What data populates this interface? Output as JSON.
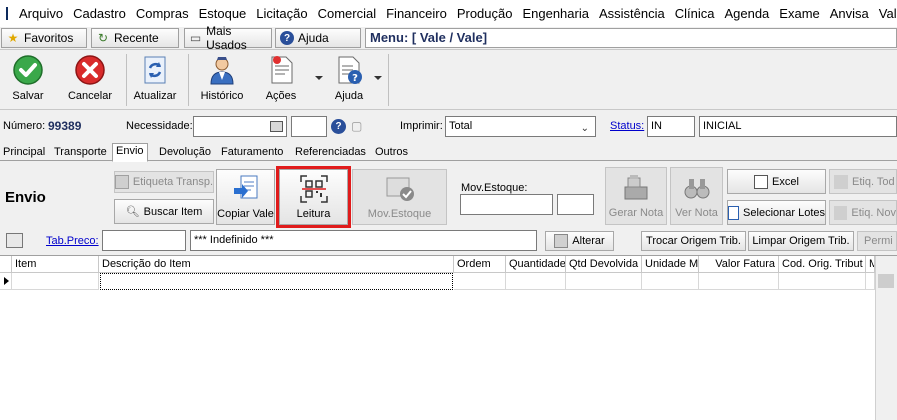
{
  "menubar": {
    "items": [
      "Arquivo",
      "Cadastro",
      "Compras",
      "Estoque",
      "Licitação",
      "Comercial",
      "Financeiro",
      "Produção",
      "Engenharia",
      "Assistência",
      "Clínica",
      "Agenda",
      "Exame",
      "Anvisa",
      "Vale"
    ]
  },
  "favbar": {
    "favoritos": "Favoritos",
    "recente": "Recente",
    "mais_usados": "Mais Usados",
    "ajuda": "Ajuda",
    "menu_path": "Menu: [ Vale / Vale]"
  },
  "toolbar": {
    "salvar": "Salvar",
    "cancelar": "Cancelar",
    "atualizar": "Atualizar",
    "historico": "Histórico",
    "acoes": "Ações",
    "ajuda": "Ajuda"
  },
  "form": {
    "numero_label": "Número:",
    "numero_value": "99389",
    "necessidade_label": "Necessidade:",
    "necessidade_value": "",
    "imprimir_label": "Imprimir:",
    "imprimir_value": "Total",
    "status_label": "Status:",
    "status_code": "IN",
    "status_desc": "INICIAL"
  },
  "tabs": [
    "Principal",
    "Transporte",
    "Envio",
    "Devolução",
    "Faturamento",
    "Referenciadas",
    "Outros"
  ],
  "active_tab": "Envio",
  "envio": {
    "title": "Envio",
    "etiqueta_transp": "Etiqueta Transp.",
    "buscar_item": "Buscar Item",
    "copiar_vale": "Copiar Vale",
    "leitura": "Leitura",
    "mov_estoque_btn": "Mov.Estoque",
    "mov_estoque_label": "Mov.Estoque:",
    "gerar_nota": "Gerar Nota",
    "ver_nota": "Ver Nota",
    "excel": "Excel",
    "selecionar_lotes": "Selecionar Lotes",
    "etiq_todos": "Etiq. Tod",
    "etiq_novos": "Etiq. Nov"
  },
  "pricebar": {
    "tab_preco_label": "Tab.Preco:",
    "tab_preco_value": "",
    "indefinido": "*** Indefinido ***",
    "alterar": "Alterar",
    "trocar_origem": "Trocar Origem Trib.",
    "limpar_origem": "Limpar Origem Trib.",
    "permitir": "Permi"
  },
  "grid": {
    "columns": [
      "Item",
      "Descrição do Item",
      "Ordem",
      "Quantidade",
      "Qtd Devolvida",
      "Unidade Me",
      "Valor Fatura",
      "Cod. Orig. Tribut",
      "M"
    ]
  },
  "colors": {
    "highlight": "#e01b1b",
    "link": "#0000cc",
    "numero": "#1f2f5f"
  }
}
